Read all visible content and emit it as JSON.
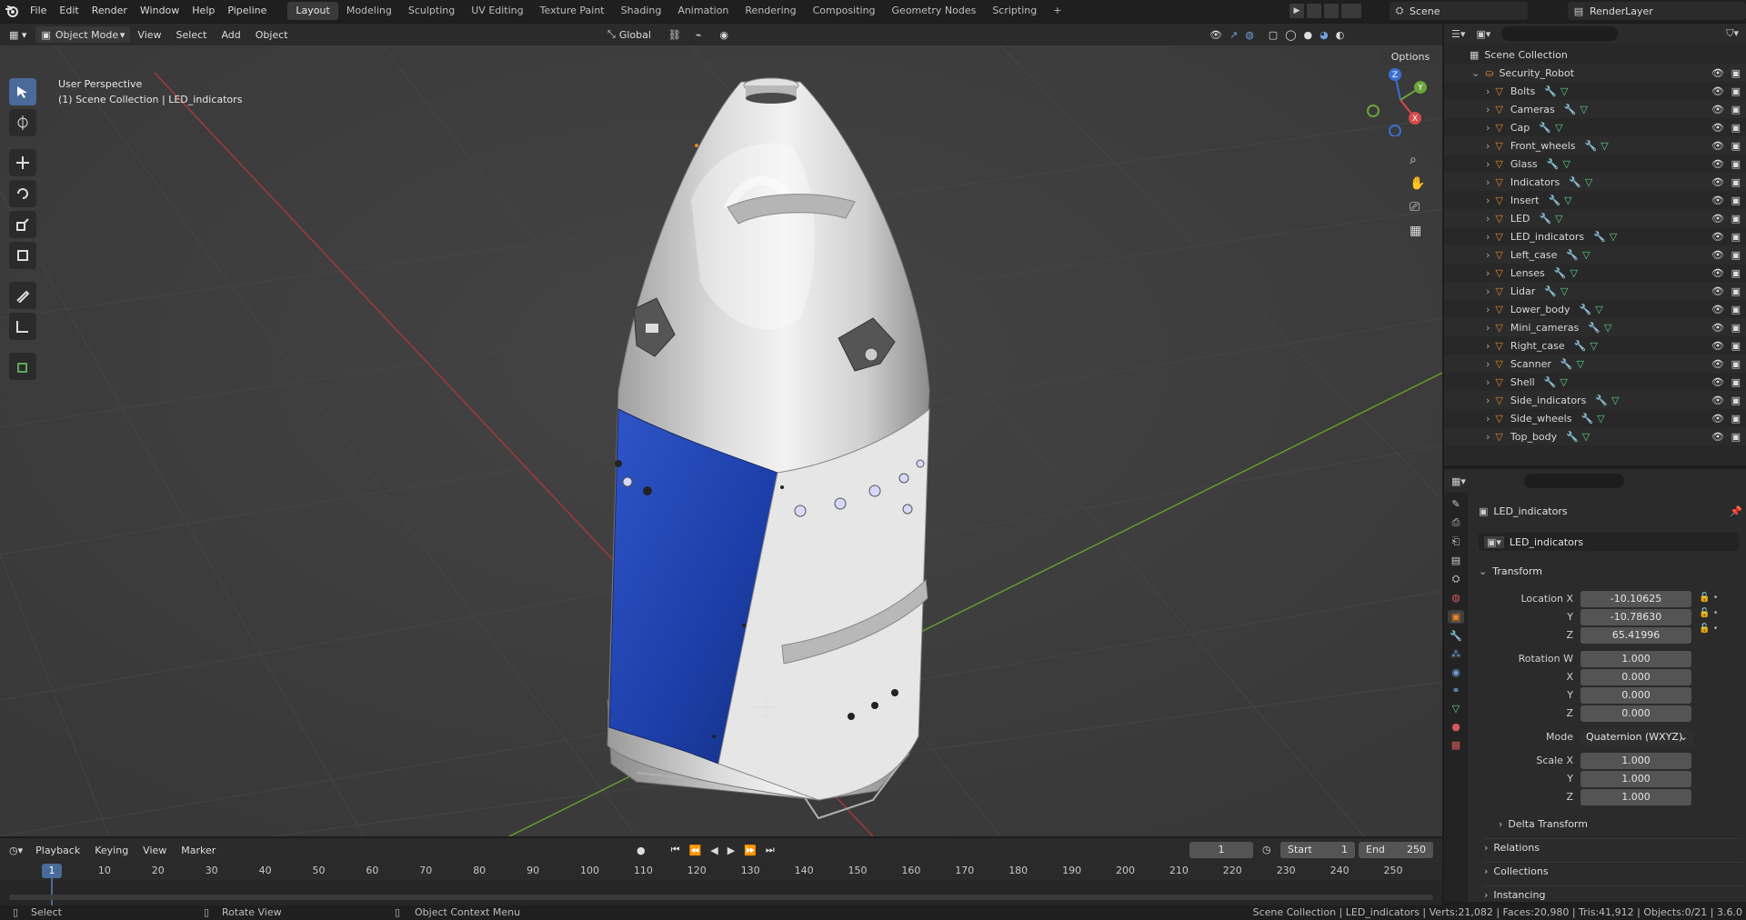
{
  "topbar": {
    "menus": [
      "File",
      "Edit",
      "Render",
      "Window",
      "Help",
      "Pipeline"
    ],
    "workspaces": [
      "Layout",
      "Modeling",
      "Sculpting",
      "UV Editing",
      "Texture Paint",
      "Shading",
      "Animation",
      "Rendering",
      "Compositing",
      "Geometry Nodes",
      "Scripting"
    ],
    "active_workspace": "Layout",
    "scene_name": "Scene",
    "render_layer": "RenderLayer"
  },
  "viewport_header": {
    "mode": "Object Mode",
    "menus": [
      "View",
      "Select",
      "Add",
      "Object"
    ],
    "transform_orientation": "Global",
    "options_label": "Options"
  },
  "viewport": {
    "perspective_label": "User Perspective",
    "context_label": "(1) Scene Collection | LED_indicators"
  },
  "outliner": {
    "root": "Scene Collection",
    "collection": "Security_Robot",
    "items": [
      "Bolts",
      "Cameras",
      "Cap",
      "Front_wheels",
      "Glass",
      "Indicators",
      "Insert",
      "LED",
      "LED_indicators",
      "Left_case",
      "Lenses",
      "Lidar",
      "Lower_body",
      "Mini_cameras",
      "Right_case",
      "Scanner",
      "Shell",
      "Side_indicators",
      "Side_wheels",
      "Top_body"
    ]
  },
  "properties": {
    "object_name": "LED_indicators",
    "object_field": "LED_indicators",
    "transform_label": "Transform",
    "location": {
      "label": "Location X",
      "x": "-10.10625",
      "y": "-10.78630",
      "z": "65.41996"
    },
    "rotation": {
      "label": "Rotation W",
      "w": "1.000",
      "x": "0.000",
      "y": "0.000",
      "z": "0.000"
    },
    "mode_label": "Mode",
    "mode_value": "Quaternion (WXYZ)",
    "scale": {
      "label": "Scale X",
      "x": "1.000",
      "y": "1.000",
      "z": "1.000"
    },
    "axis_labels": {
      "x": "X",
      "y": "Y",
      "z": "Z"
    },
    "sections": [
      "Delta Transform",
      "Relations",
      "Collections",
      "Instancing"
    ]
  },
  "timeline": {
    "menus": [
      "Playback",
      "Keying",
      "View",
      "Marker"
    ],
    "current_frame": "1",
    "start_label": "Start",
    "start": "1",
    "end_label": "End",
    "end": "250",
    "ticks": [
      "10",
      "20",
      "30",
      "40",
      "50",
      "60",
      "70",
      "80",
      "90",
      "100",
      "110",
      "120",
      "130",
      "140",
      "150",
      "160",
      "170",
      "180",
      "190",
      "200",
      "210",
      "220",
      "230",
      "240",
      "250"
    ]
  },
  "statusbar": {
    "select": "Select",
    "rotate": "Rotate View",
    "context_menu": "Object Context Menu",
    "stats": "Scene Collection | LED_indicators | Verts:21,082 | Faces:20,980 | Tris:41,912 | Objects:0/21 | 3.6.0"
  },
  "colors": {
    "accent": "#4a6a99",
    "object_orange": "#e8862a",
    "modifier_blue": "#6e9fd8",
    "mesh_green": "#5fd08a",
    "robot_blue": "#1c3ea8"
  }
}
